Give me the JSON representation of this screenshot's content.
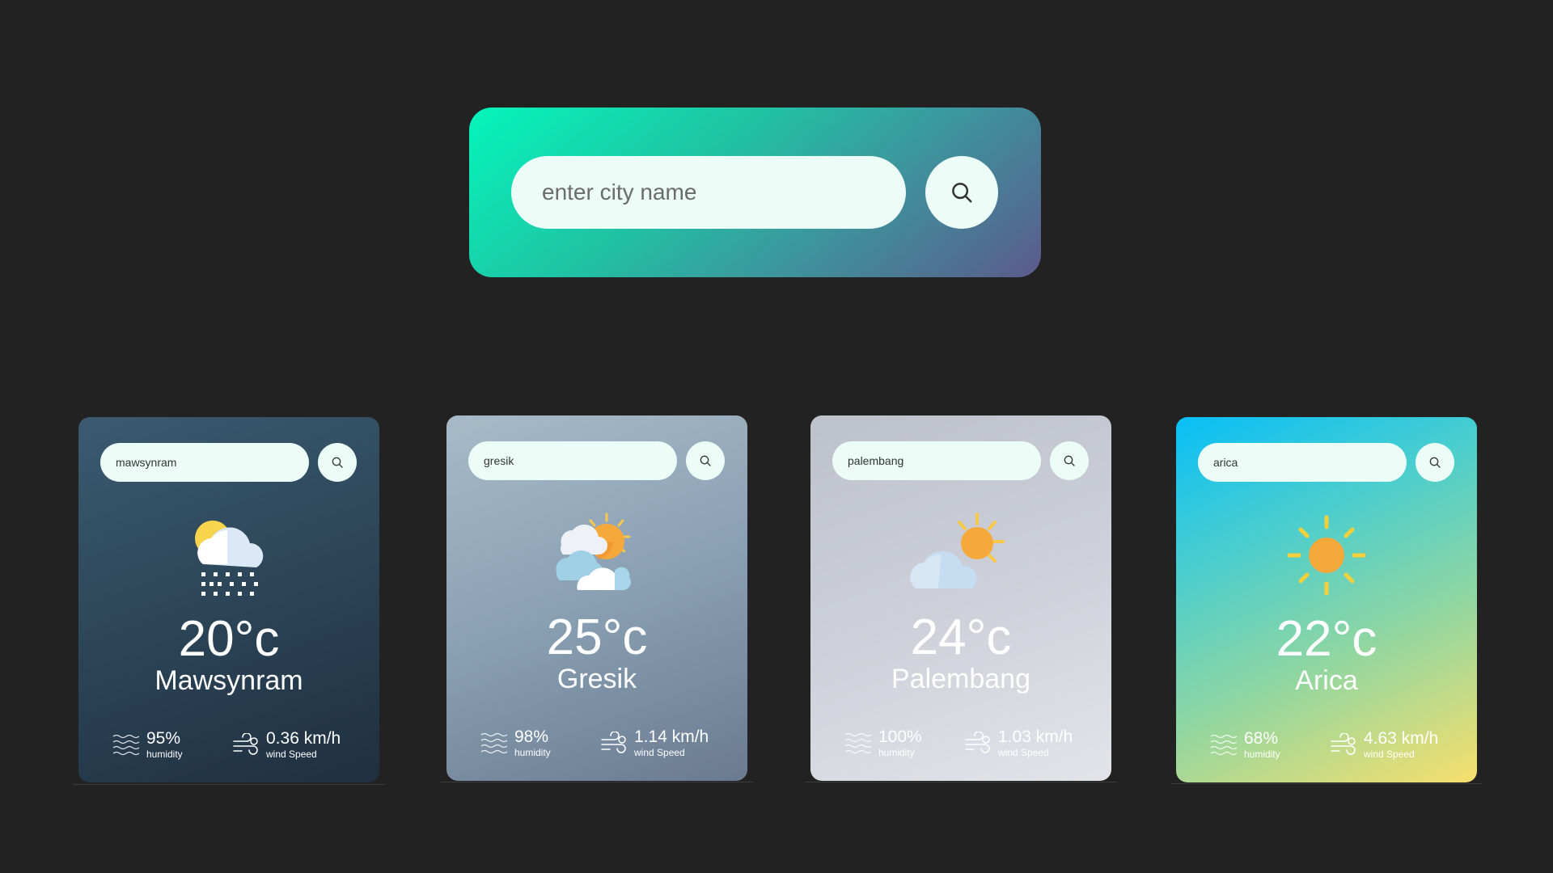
{
  "search": {
    "placeholder": "enter city name"
  },
  "cards": [
    {
      "input_value": "mawsynram",
      "icon": "snow-cloud-sun-icon",
      "temp": "20°c",
      "city": "Mawsynram",
      "humidity": "95%",
      "humidity_label": "humidity",
      "wind": "0.36 km/h",
      "wind_label": "wind Speed"
    },
    {
      "input_value": "gresik",
      "icon": "partly-cloudy-icon",
      "temp": "25°c",
      "city": "Gresik",
      "humidity": "98%",
      "humidity_label": "humidity",
      "wind": "1.14 km/h",
      "wind_label": "wind Speed"
    },
    {
      "input_value": "palembang",
      "icon": "sun-behind-cloud-icon",
      "temp": "24°c",
      "city": "Palembang",
      "humidity": "100%",
      "humidity_label": "humidity",
      "wind": "1.03 km/h",
      "wind_label": "wind Speed"
    },
    {
      "input_value": "arica",
      "icon": "sun-icon",
      "temp": "22°c",
      "city": "Arica",
      "humidity": "68%",
      "humidity_label": "humidity",
      "wind": "4.63 km/h",
      "wind_label": "wind Speed"
    }
  ],
  "colors": {
    "background": "#222222",
    "input_bg": "#ecfdf8"
  }
}
